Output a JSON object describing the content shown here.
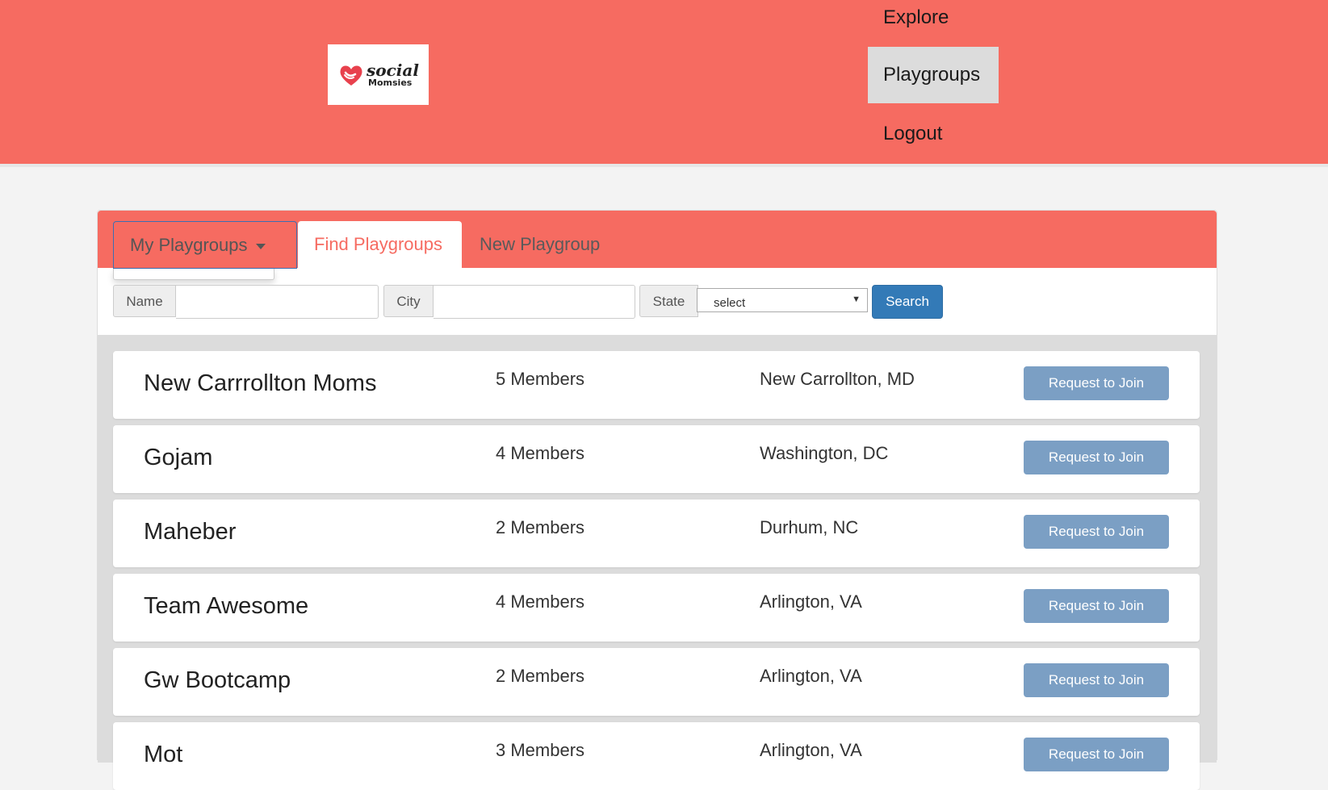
{
  "header": {
    "logo": {
      "word1": "social",
      "word2": "Momsies",
      "icon": "heart-hand-icon"
    },
    "nav": [
      {
        "label": "Explore"
      },
      {
        "label": "Playgroups",
        "active": true
      },
      {
        "label": "Logout"
      }
    ],
    "brand_color": "#f66b61"
  },
  "tabs": {
    "my": "My Playgroups",
    "find": "Find Playgroups",
    "new": "New Playgroup",
    "active": "find"
  },
  "search": {
    "name_label": "Name",
    "name_value": "",
    "city_label": "City",
    "city_value": "",
    "state_label": "State",
    "state_value": "select",
    "button": "Search"
  },
  "playgroups": [
    {
      "name": "New Carrrollton Moms",
      "members": "5 Members",
      "location": "New Carrollton, MD",
      "action": "Request to Join"
    },
    {
      "name": "Gojam",
      "members": "4 Members",
      "location": "Washington, DC",
      "action": "Request to Join"
    },
    {
      "name": "Maheber",
      "members": "2 Members",
      "location": "Durhum, NC",
      "action": "Request to Join"
    },
    {
      "name": "Team Awesome",
      "members": "4 Members",
      "location": "Arlington, VA",
      "action": "Request to Join"
    },
    {
      "name": "Gw Bootcamp",
      "members": "2 Members",
      "location": "Arlington, VA",
      "action": "Request to Join"
    },
    {
      "name": "Mot",
      "members": "3 Members",
      "location": "Arlington, VA",
      "action": "Request to Join"
    }
  ]
}
